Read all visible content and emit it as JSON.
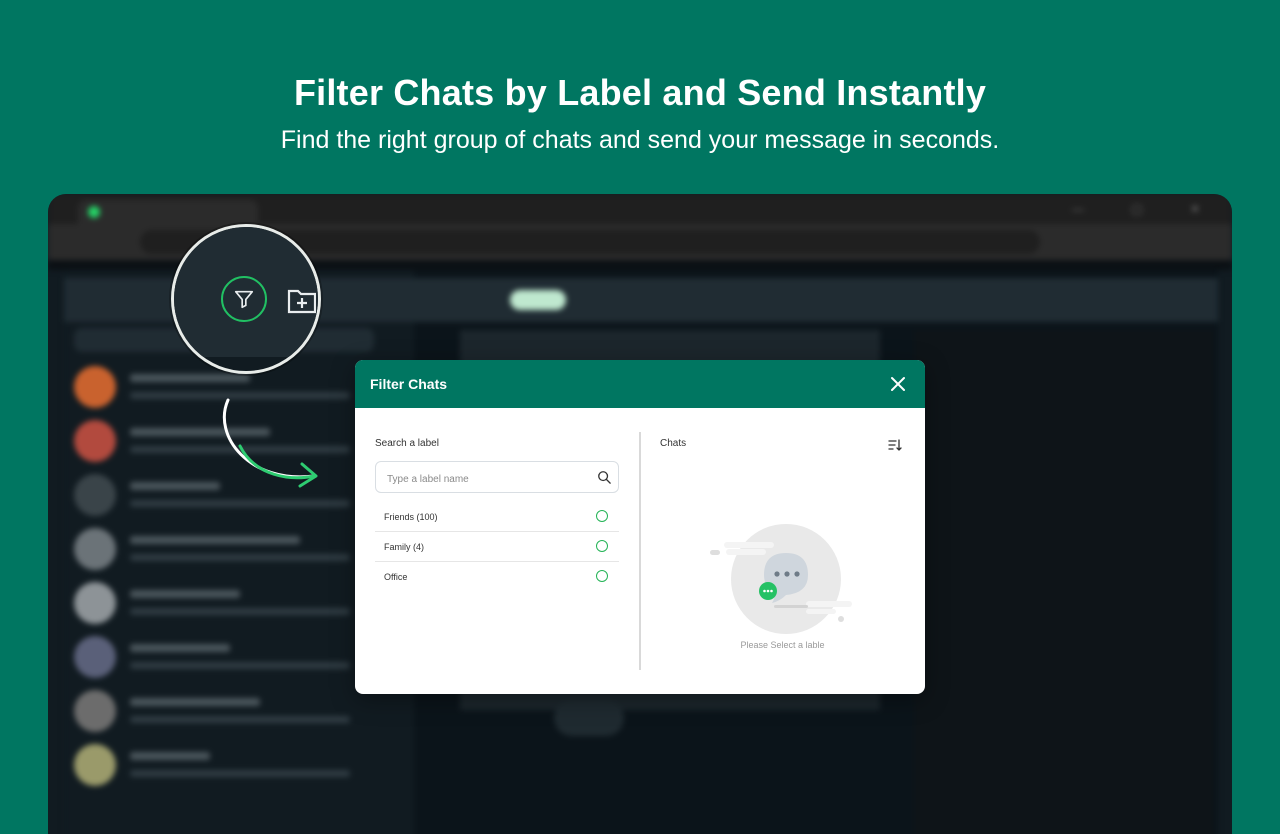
{
  "hero": {
    "title": "Filter Chats by Label and Send Instantly",
    "subtitle": "Find the right group of chats and send your message in seconds."
  },
  "modal": {
    "title": "Filter Chats",
    "close_icon": "close-icon",
    "left": {
      "heading": "Search a label",
      "search_placeholder": "Type a label name",
      "search_value": "",
      "labels": [
        {
          "name": "Friends (100)",
          "selected": false
        },
        {
          "name": "Family (4)",
          "selected": false
        },
        {
          "name": "Office",
          "selected": false
        }
      ]
    },
    "right": {
      "heading": "Chats",
      "sort_icon": "sort-icon",
      "empty_message": "Please Select a lable"
    }
  },
  "colors": {
    "background": "#007661",
    "header": "#007661",
    "accent_green": "#25d366",
    "radio_green": "#25b457"
  },
  "icons": [
    "filter-icon",
    "new-chat-icon",
    "search-icon",
    "sort-icon",
    "close-icon",
    "arrow-icon"
  ]
}
